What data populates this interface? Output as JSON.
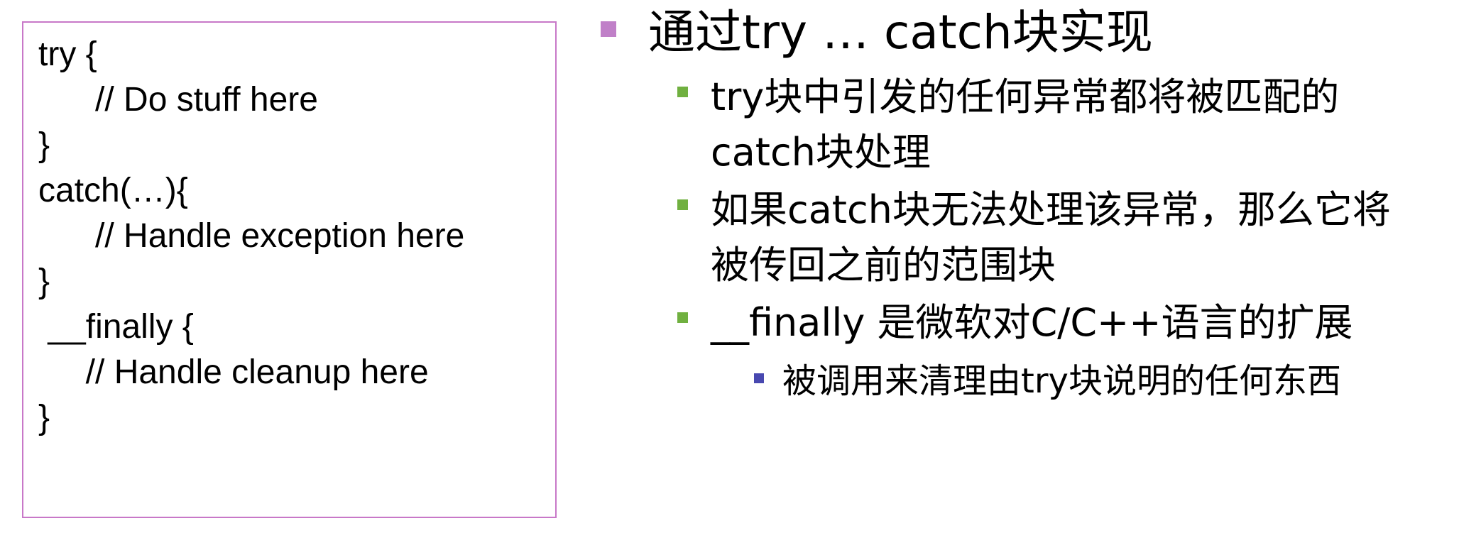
{
  "code": {
    "lines": [
      "try {",
      "      // Do stuff here",
      "}",
      "catch(…){",
      "      // Handle exception here",
      "}",
      " __finally {",
      "     // Handle cleanup here",
      "}"
    ]
  },
  "bullets": {
    "b1": {
      "text": "通过try … catch块实现",
      "marker_color": "#c080c8"
    },
    "b2": {
      "text": "try块中引发的任何异常都将被匹配的\ncatch块处理",
      "marker_color": "#70b040"
    },
    "b3": {
      "text": "如果catch块无法处理该异常，那么它将\n被传回之前的范围块",
      "marker_color": "#70b040"
    },
    "b4": {
      "text": "__finally 是微软对C/C++语言的扩展",
      "marker_color": "#70b040"
    },
    "b5": {
      "text": "被调用来清理由try块说明的任何东西",
      "marker_color": "#4848b0"
    }
  },
  "colors": {
    "code_box_border": "#c878c8"
  }
}
